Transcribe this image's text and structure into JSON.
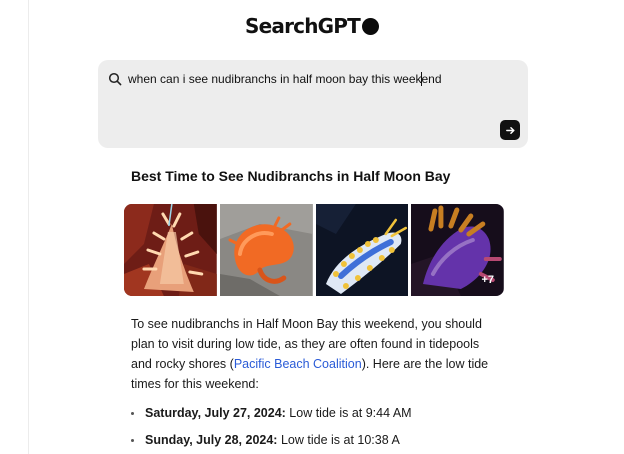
{
  "app": {
    "logo_text": "SearchGPT"
  },
  "search": {
    "query": "when can i see nudibranchs in half moon bay this weekend",
    "submit_icon": "arrow-right-icon",
    "search_icon": "search-icon"
  },
  "result": {
    "title": "Best Time to See Nudibranchs in Half Moon Bay",
    "gallery": {
      "images": [
        {
          "name": "red-spiny-nudibranch-image"
        },
        {
          "name": "orange-nudibranch-image"
        },
        {
          "name": "yellow-blue-nudibranch-image"
        },
        {
          "name": "purple-orange-nudibranch-image"
        }
      ],
      "more_count": "+7"
    },
    "paragraph": {
      "before_link": "To see nudibranchs in Half Moon Bay this weekend, you should plan to visit during low tide, as they are often found in tidepools and rocky shores (",
      "link_text": "Pacific Beach Coalition",
      "after_link": "). Here are the low tide times for this weekend:"
    },
    "tides": [
      {
        "date": "Saturday, July 27, 2024:",
        "text": " Low tide is at 9:44 AM"
      },
      {
        "date": "Sunday, July 28, 2024:",
        "text": " Low tide is at 10:38 A"
      }
    ]
  },
  "colors": {
    "link": "#2a5bd7",
    "search_bg": "#ededed"
  }
}
